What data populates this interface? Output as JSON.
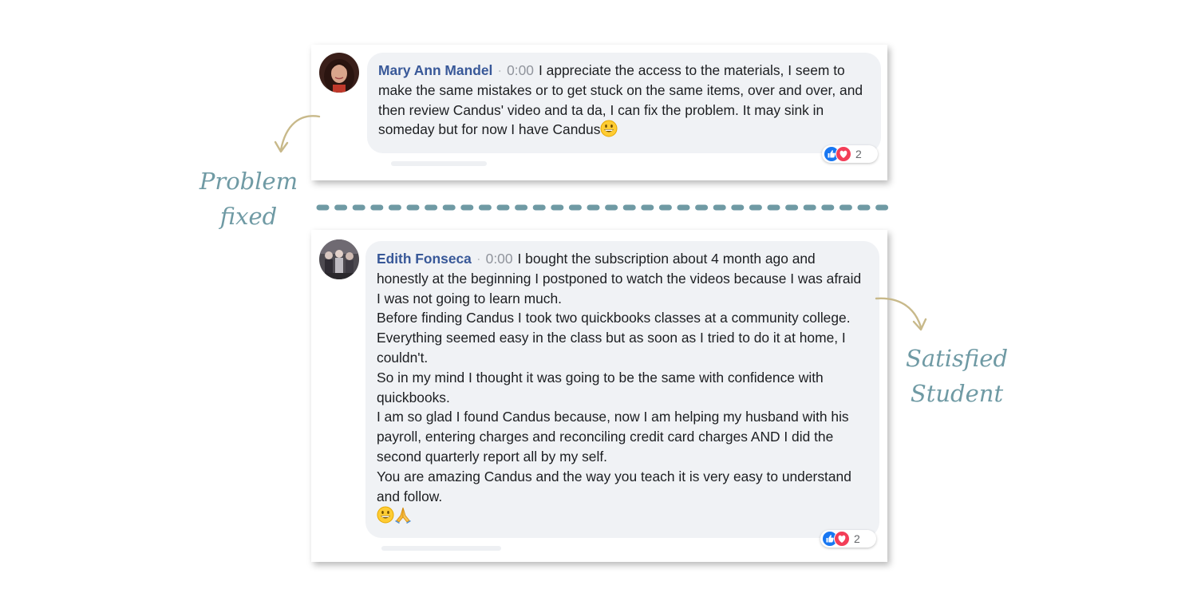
{
  "comments": [
    {
      "author": "Mary Ann Mandel",
      "time": "0:00",
      "paragraphs": [
        "I appreciate the access to the materials, I seem to make the same mistakes or to get stuck on the same items, over and over, and then review Candus' video and ta da, I can fix the problem. It may sink in someday but for now I have Candus"
      ],
      "trailing_emoji": "grinning-face",
      "reaction_count": "2"
    },
    {
      "author": "Edith Fonseca",
      "time": "0:00",
      "paragraphs": [
        "I bought the subscription about 4 month ago and honestly at the beginning I postponed to watch the videos because I was afraid I was not going to learn much.",
        "Before finding Candus I took two quickbooks classes at a community college. Everything seemed easy in the class but as soon as I tried to do it at home, I couldn't.",
        "So in my mind I thought it was going to be the same with confidence with quickbooks.",
        "I am so glad I found Candus because, now I am helping my husband with his payroll, entering charges and reconciling credit card charges AND I did the second quarterly report all by my self.",
        "You are amazing Candus and the way you teach it is very easy to understand and follow."
      ],
      "trailing_emoji": [
        "grinning-face",
        "folded-hands"
      ],
      "reaction_count": "2"
    }
  ],
  "annotations": {
    "left": [
      "Problem",
      "fixed"
    ],
    "right": [
      "Satisfied",
      "Student"
    ]
  },
  "icons": [
    "like-icon",
    "love-icon",
    "grinning-face-emoji",
    "folded-hands-emoji",
    "curved-arrow-icon"
  ],
  "colors": {
    "author_name": "#385898",
    "bubble_bg": "#f0f2f5",
    "annotation_text": "#6f9aa4",
    "divider": "#6f9aa4",
    "arrow": "#c8b98a",
    "like_blue": "#1877f2",
    "love_red": "#f33e58"
  }
}
